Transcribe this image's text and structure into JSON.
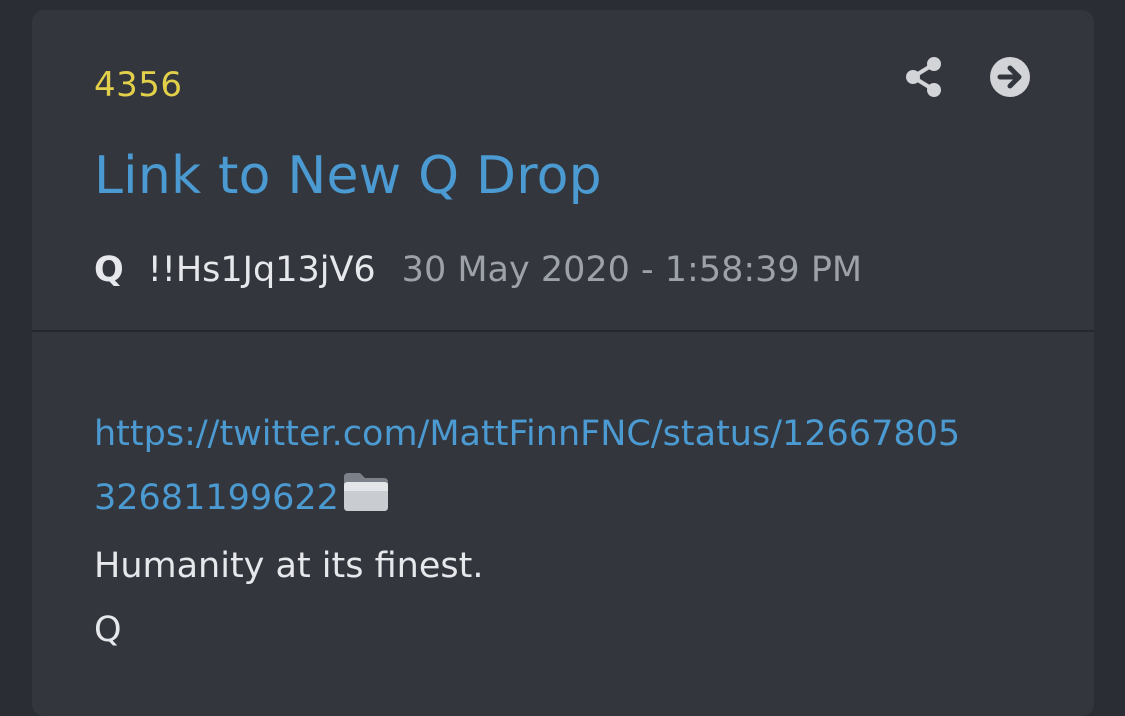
{
  "post": {
    "number": "4356",
    "title": "Link to New Q Drop",
    "author": "Q",
    "tripcode": "!!Hs1Jq13jV6",
    "timestamp": "30 May 2020 - 1:58:39 PM",
    "link_line1": "https://twitter.com/MattFinnFNC/status/12667805",
    "link_line2": "32681199622",
    "body_line": "Humanity at its finest.",
    "signature": "Q"
  },
  "icons": {
    "share": "share-icon",
    "open": "arrow-circle-right-icon",
    "folder": "folder-icon"
  },
  "colors": {
    "background": "#2a2d33",
    "card": "#33363d",
    "number": "#e2cf4a",
    "link": "#4b9ad1",
    "text": "#e6e8ec",
    "muted": "#9da1a8"
  }
}
